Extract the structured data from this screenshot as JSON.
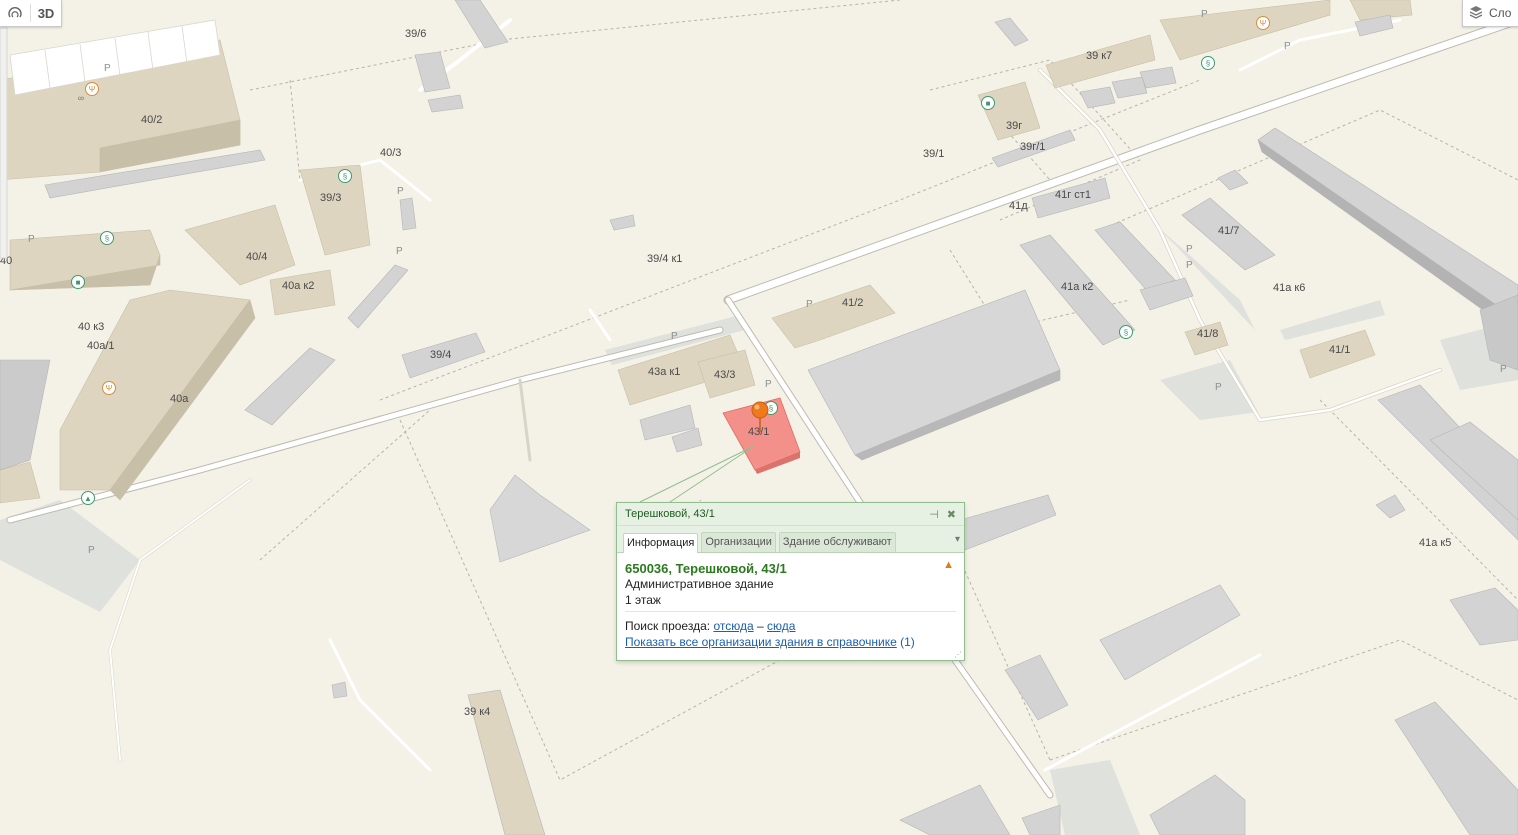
{
  "map": {
    "building_labels": [
      {
        "id": "b-39-6",
        "text": "39/6"
      },
      {
        "id": "b-40-2",
        "text": "40/2"
      },
      {
        "id": "b-40-3",
        "text": "40/3"
      },
      {
        "id": "b-39-3",
        "text": "39/3"
      },
      {
        "id": "b-40-4",
        "text": "40/4"
      },
      {
        "id": "b-40a-k2",
        "text": "40а к2"
      },
      {
        "id": "b-40-k3",
        "text": "40 к3"
      },
      {
        "id": "b-40a-1",
        "text": "40а/1"
      },
      {
        "id": "b-40a",
        "text": "40а"
      },
      {
        "id": "b-40",
        "text": "40"
      },
      {
        "id": "b-39-4",
        "text": "39/4"
      },
      {
        "id": "b-39-4-k1",
        "text": "39/4 к1"
      },
      {
        "id": "b-43a-k1",
        "text": "43а к1"
      },
      {
        "id": "b-43-3",
        "text": "43/3"
      },
      {
        "id": "b-43-1",
        "text": "43/1"
      },
      {
        "id": "b-41-2",
        "text": "41/2"
      },
      {
        "id": "b-39-k7",
        "text": "39 к7"
      },
      {
        "id": "b-39g",
        "text": "39г"
      },
      {
        "id": "b-39g-1",
        "text": "39г/1"
      },
      {
        "id": "b-39-1",
        "text": "39/1"
      },
      {
        "id": "b-41d",
        "text": "41д"
      },
      {
        "id": "b-41g-st1",
        "text": "41г ст1"
      },
      {
        "id": "b-41a-k2",
        "text": "41а к2"
      },
      {
        "id": "b-41-7",
        "text": "41/7"
      },
      {
        "id": "b-41a-k6",
        "text": "41а к6"
      },
      {
        "id": "b-41-8",
        "text": "41/8"
      },
      {
        "id": "b-41-1",
        "text": "41/1"
      },
      {
        "id": "b-41a-k5",
        "text": "41а к5"
      },
      {
        "id": "b-39-k4",
        "text": "39 к4"
      }
    ],
    "parking_label": "P",
    "colors": {
      "background": "#f4f1e6",
      "building": "#dcd4bf",
      "building_gray": "#d0d0d0",
      "road": "#ffffff",
      "selected": "#f48a80",
      "marker": "#f07a1a"
    }
  },
  "controls": {
    "ruler_icon": "ruler-icon",
    "mode_3d": "3D",
    "layers_icon": "layers-icon",
    "layers_label": "Сло"
  },
  "popup": {
    "title": "Терешковой, 43/1",
    "pin_icon": "pin-icon",
    "close_icon": "close-icon",
    "tabs": [
      {
        "label": "Информация",
        "active": true
      },
      {
        "label": "Организации",
        "active": false
      },
      {
        "label": "Здание обслуживают",
        "active": false
      }
    ],
    "address": "650036, Терешковой, 43/1",
    "warning_icon": "warning-icon",
    "building_type": "Административное здание",
    "floors": "1 этаж",
    "route_label": "Поиск проезда:",
    "route_from": "отсюда",
    "route_dash": "–",
    "route_to": "сюда",
    "show_orgs_link": "Показать все организации здания в справочнике",
    "orgs_count": "(1)"
  }
}
